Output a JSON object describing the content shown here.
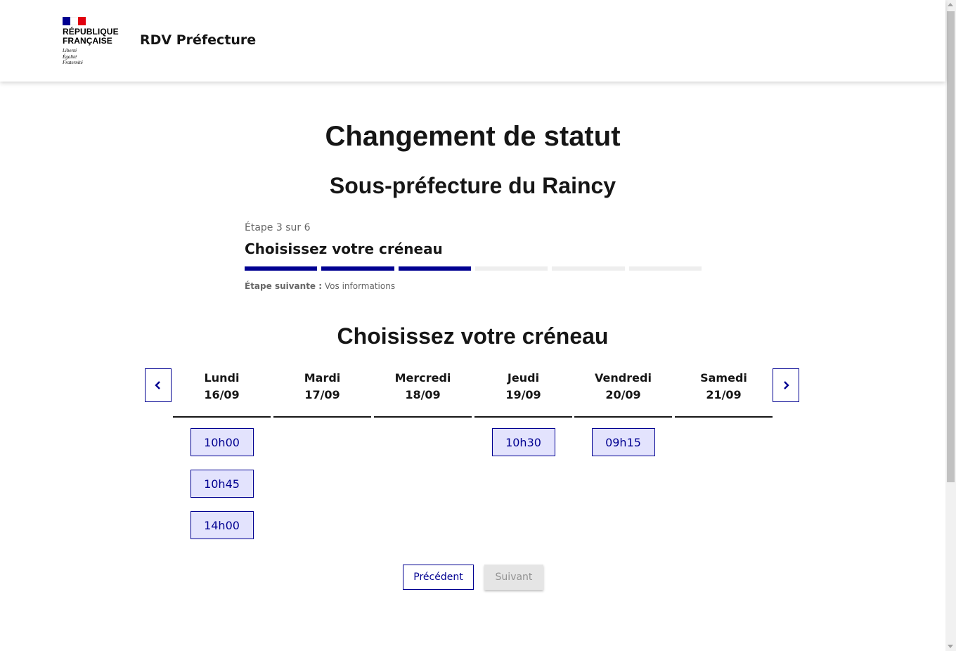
{
  "header": {
    "logo_line1": "RÉPUBLIQUE",
    "logo_line2": "FRANÇAISE",
    "motto1": "Liberté",
    "motto2": "Égalité",
    "motto3": "Fraternité",
    "site_title": "RDV Préfecture"
  },
  "page": {
    "title": "Changement de statut",
    "subtitle": "Sous-préfecture du Raincy"
  },
  "stepper": {
    "state": "Étape 3 sur 6",
    "current_title": "Choisissez votre créneau",
    "current_step": 3,
    "total_steps": 6,
    "next_label": "Étape suivante :",
    "next_value": "Vos informations"
  },
  "calendar": {
    "title": "Choisissez votre créneau",
    "days": [
      {
        "name": "Lundi",
        "date": "16/09",
        "slots": [
          "10h00",
          "10h45",
          "14h00"
        ]
      },
      {
        "name": "Mardi",
        "date": "17/09",
        "slots": []
      },
      {
        "name": "Mercredi",
        "date": "18/09",
        "slots": []
      },
      {
        "name": "Jeudi",
        "date": "19/09",
        "slots": [
          "10h30"
        ]
      },
      {
        "name": "Vendredi",
        "date": "20/09",
        "slots": [
          "09h15"
        ]
      },
      {
        "name": "Samedi",
        "date": "21/09",
        "slots": []
      }
    ]
  },
  "actions": {
    "previous": "Précédent",
    "next": "Suivant"
  },
  "icons": {
    "prev": "chevron-left-icon",
    "next": "chevron-right-icon"
  },
  "colors": {
    "primary": "#000091",
    "slot_bg": "#e3e3fd",
    "flag_red": "#e1000f",
    "disabled_bg": "#e5e5e5",
    "disabled_text": "#929292"
  }
}
